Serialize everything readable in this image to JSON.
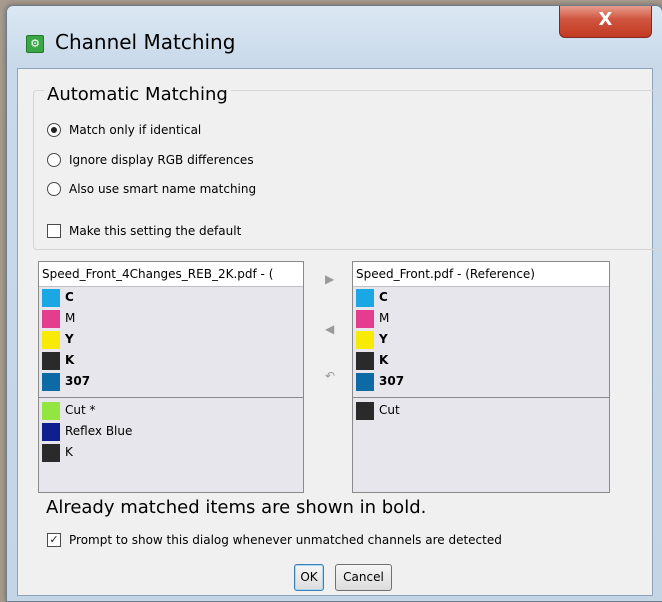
{
  "window": {
    "title": "Channel Matching",
    "close_label": "X"
  },
  "automatic_matching": {
    "heading": "Automatic Matching",
    "options": [
      {
        "label": "Match only if identical",
        "selected": true
      },
      {
        "label": "Ignore display RGB differences",
        "selected": false
      },
      {
        "label": "Also use smart name matching",
        "selected": false
      }
    ],
    "default_checkbox": {
      "label": "Make this setting the default",
      "checked": false
    }
  },
  "left_list": {
    "header": "Speed_Front_4Changes_REB_2K.pdf - (",
    "matched": [
      {
        "name": "C",
        "color": "#1aa7e4"
      },
      {
        "name": "M",
        "color": "#e43d8f"
      },
      {
        "name": "Y",
        "color": "#f7ea06"
      },
      {
        "name": "K",
        "color": "#2a2a2a"
      },
      {
        "name": "307",
        "color": "#0e6aa4"
      }
    ],
    "unmatched": [
      {
        "name": "Cut *",
        "color": "#93e640"
      },
      {
        "name": "Reflex Blue",
        "color": "#0f1f8f"
      },
      {
        "name": "K",
        "color": "#2a2a2a"
      }
    ]
  },
  "right_list": {
    "header": "Speed_Front.pdf - (Reference)",
    "matched": [
      {
        "name": "C",
        "color": "#1aa7e4"
      },
      {
        "name": "M",
        "color": "#e43d8f"
      },
      {
        "name": "Y",
        "color": "#f7ea06"
      },
      {
        "name": "K",
        "color": "#2a2a2a"
      },
      {
        "name": "307",
        "color": "#0e6aa4"
      }
    ],
    "unmatched": [
      {
        "name": "Cut",
        "color": "#2a2a2a"
      }
    ]
  },
  "arrows": {
    "right": "▶",
    "left": "◀",
    "undo": "↶"
  },
  "info_text": "Already matched items are shown in bold.",
  "prompt_checkbox": {
    "label": "Prompt to show this dialog whenever unmatched channels are detected",
    "checked": true
  },
  "buttons": {
    "ok": "OK",
    "cancel": "Cancel"
  }
}
